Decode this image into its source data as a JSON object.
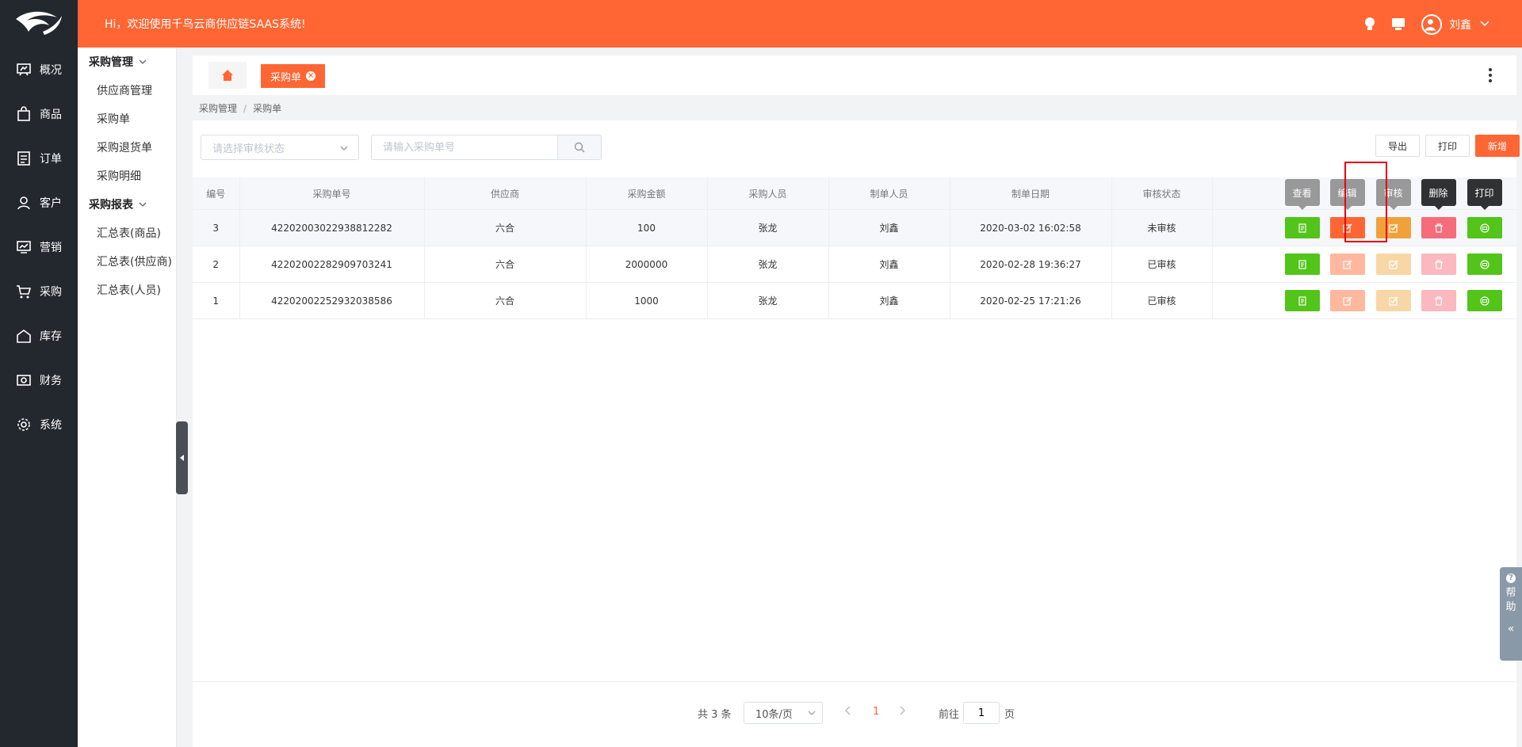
{
  "topbar": {
    "greeting": "Hi，欢迎使用千鸟云商供应链SAAS系统!",
    "user_name": "刘鑫"
  },
  "nav": {
    "items": [
      {
        "label": "概况",
        "icon": "overview-icon"
      },
      {
        "label": "商品",
        "icon": "bag-icon"
      },
      {
        "label": "订单",
        "icon": "order-icon"
      },
      {
        "label": "客户",
        "icon": "user-icon"
      },
      {
        "label": "营销",
        "icon": "marketing-icon"
      },
      {
        "label": "采购",
        "icon": "cart-icon"
      },
      {
        "label": "库存",
        "icon": "warehouse-icon"
      },
      {
        "label": "财务",
        "icon": "finance-icon"
      },
      {
        "label": "系统",
        "icon": "gear-icon"
      }
    ]
  },
  "submenu": {
    "group1": "采购管理",
    "group1_items": [
      "供应商管理",
      "采购单",
      "采购退货单",
      "采购明细"
    ],
    "group2": "采购报表",
    "group2_items": [
      "汇总表(商品)",
      "汇总表(供应商)",
      "汇总表(人员)"
    ]
  },
  "tabs": {
    "active": "采购单"
  },
  "breadcrumb": {
    "parent": "采购管理",
    "sep": "/",
    "current": "采购单"
  },
  "filters": {
    "status_placeholder": "请选择审核状态",
    "search_placeholder": "请输入采购单号"
  },
  "actions": {
    "export": "导出",
    "print": "打印",
    "new": "新增"
  },
  "table": {
    "headers": [
      "编号",
      "采购单号",
      "供应商",
      "采购金额",
      "采购人员",
      "制单人员",
      "制单日期",
      "审核状态"
    ],
    "op_labels": [
      "查看",
      "编辑",
      "审核",
      "删除",
      "打印"
    ],
    "rows": [
      {
        "id": "3",
        "order_no": "4220200302293881​2282",
        "supplier": "六合",
        "amount": "100",
        "buyer": "张龙",
        "maker": "刘鑫",
        "date": "2020-03-02 16:02:58",
        "status": "未审核"
      },
      {
        "id": "2",
        "order_no": "42202002282909703241",
        "supplier": "六合",
        "amount": "2000000",
        "buyer": "张龙",
        "maker": "刘鑫",
        "date": "2020-02-28 19:36:27",
        "status": "已审核"
      },
      {
        "id": "1",
        "order_no": "42202002252932038586",
        "supplier": "六合",
        "amount": "1000",
        "buyer": "张龙",
        "maker": "刘鑫",
        "date": "2020-02-25 17:21:26",
        "status": "已审核"
      }
    ]
  },
  "pager": {
    "total": "共 3 条",
    "page_size": "10条/页",
    "current": "1",
    "goto": "前往",
    "jump_value": "1",
    "page_word": "页"
  },
  "help": {
    "char1": "帮",
    "char2": "助",
    "question": "?",
    "collapse": "«"
  },
  "colors": {
    "brand": "#ff6633",
    "nav_bg": "#23272e",
    "green": "#52c41a",
    "pending": "#f56c6c",
    "approved": "#19be6b"
  }
}
